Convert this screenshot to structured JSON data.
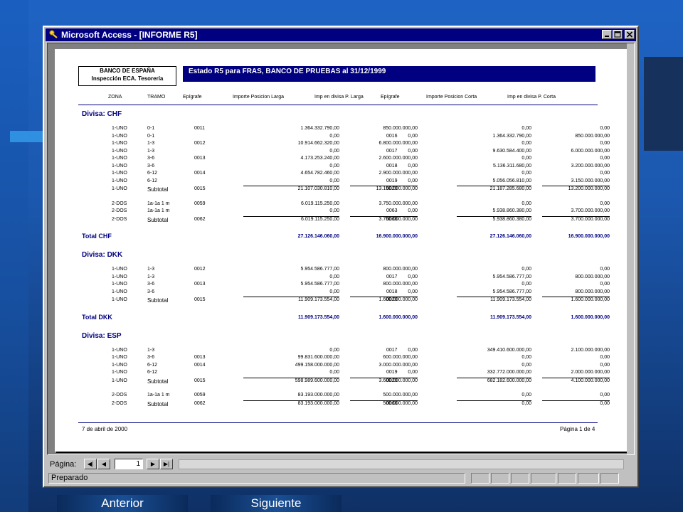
{
  "window": {
    "title": "Microsoft Access - [INFORME R5]",
    "icon": "key-icon"
  },
  "report": {
    "bank_line1": "BANCO DE ESPAÑA",
    "bank_line2": "Inspección ECA. Tesorería",
    "title": "Estado R5 para FRAS, BANCO DE PRUEBAS al 31/12/1999",
    "columns": [
      "ZONA",
      "TRAMO",
      "Epígrafe",
      "Importe Posicion Larga",
      "Imp en divisa P. Larga",
      "Epígrafe",
      "Importe Posicion Corta",
      "Imp en divisa P. Corta"
    ],
    "sections": [
      {
        "title": "Divisa: CHF",
        "total_label": "Total CHF",
        "totals": [
          "27.126.146.060,00",
          "16.900.000.000,00",
          "27.126.146.060,00",
          "16.900.000.000,00"
        ],
        "groups": [
          {
            "rows": [
              [
                "1-UNO",
                "0-1",
                "0011",
                "1.364.332.790,00",
                "850.000.000,00",
                "",
                "0,00",
                "0,00"
              ],
              [
                "1-UNO",
                "0-1",
                "",
                "0,00",
                "0,00",
                "0016",
                "1.364.332.790,00",
                "850.000.000,00"
              ],
              [
                "1-UNO",
                "1-3",
                "0012",
                "10.914.662.320,00",
                "6.800.000.000,00",
                "",
                "0,00",
                "0,00"
              ],
              [
                "1-UNO",
                "1-3",
                "",
                "0,00",
                "0,00",
                "0017",
                "9.630.584.400,00",
                "6.000.000.000,00"
              ],
              [
                "1-UNO",
                "3-6",
                "0013",
                "4.173.253.240,00",
                "2.600.000.000,00",
                "",
                "0,00",
                "0,00"
              ],
              [
                "1-UNO",
                "3-6",
                "",
                "0,00",
                "0,00",
                "0018",
                "5.136.311.680,00",
                "3.200.000.000,00"
              ],
              [
                "1-UNO",
                "6-12",
                "0014",
                "4.654.782.460,00",
                "2.900.000.000,00",
                "",
                "0,00",
                "0,00"
              ],
              [
                "1-UNO",
                "6-12",
                "",
                "0,00",
                "0,00",
                "0019",
                "5.056.056.810,00",
                "3.150.000.000,00"
              ]
            ],
            "subtotal": [
              "1-UNO",
              "Subtotal",
              "0015",
              "21.107.030.810,00",
              "13.150.000.000,00",
              "0020",
              "21.187.285.680,00",
              "13.200.000.000,00"
            ]
          },
          {
            "rows": [
              [
                "2-DOS",
                "1a-1a 1 m",
                "0059",
                "6.019.115.250,00",
                "3.750.000.000,00",
                "",
                "0,00",
                "0,00"
              ],
              [
                "2-DOS",
                "1a-1a 1 m",
                "",
                "0,00",
                "0,00",
                "0063",
                "5.938.860.380,00",
                "3.700.000.000,00"
              ]
            ],
            "subtotal": [
              "2-DOS",
              "Subtotal",
              "0062",
              "6.019.115.250,00",
              "3.750.000.000,00",
              "0066",
              "5.938.860.380,00",
              "3.700.000.000,00"
            ]
          }
        ]
      },
      {
        "title": "Divisa: DKK",
        "total_label": "Total DKK",
        "totals": [
          "11.909.173.554,00",
          "1.600.000.000,00",
          "11.909.173.554,00",
          "1.600.000.000,00"
        ],
        "groups": [
          {
            "rows": [
              [
                "1-UNO",
                "1-3",
                "0012",
                "5.954.586.777,00",
                "800.000.000,00",
                "",
                "0,00",
                "0,00"
              ],
              [
                "1-UNO",
                "1-3",
                "",
                "0,00",
                "0,00",
                "0017",
                "5.954.586.777,00",
                "800.000.000,00"
              ],
              [
                "1-UNO",
                "3-6",
                "0013",
                "5.954.586.777,00",
                "800.000.000,00",
                "",
                "0,00",
                "0,00"
              ],
              [
                "1-UNO",
                "3-6",
                "",
                "0,00",
                "0,00",
                "0018",
                "5.954.586.777,00",
                "800.000.000,00"
              ]
            ],
            "subtotal": [
              "1-UNO",
              "Subtotal",
              "0015",
              "11.909.173.554,00",
              "1.600.000.000,00",
              "0020",
              "11.909.173.554,00",
              "1.600.000.000,00"
            ]
          }
        ]
      },
      {
        "title": "Divisa: ESP",
        "groups": [
          {
            "rows": [
              [
                "1-UNO",
                "1-3",
                "",
                "0,00",
                "0,00",
                "0017",
                "349.410.600.000,00",
                "2.100.000.000,00"
              ],
              [
                "1-UNO",
                "3-6",
                "0013",
                "99.831.600.000,00",
                "600.000.000,00",
                "",
                "0,00",
                "0,00"
              ],
              [
                "1-UNO",
                "6-12",
                "0014",
                "499.158.000.000,00",
                "3.000.000.000,00",
                "",
                "0,00",
                "0,00"
              ],
              [
                "1-UNO",
                "6-12",
                "",
                "0,00",
                "0,00",
                "0019",
                "332.772.000.000,00",
                "2.000.000.000,00"
              ]
            ],
            "subtotal": [
              "1-UNO",
              "Subtotal",
              "0015",
              "598.989.600.000,00",
              "3.600.000.000,00",
              "0020",
              "682.182.600.000,00",
              "4.100.000.000,00"
            ]
          },
          {
            "rows": [
              [
                "2-DOS",
                "1a-1a 1 m",
                "0059",
                "83.193.000.000,00",
                "500.000.000,00",
                "",
                "0,00",
                "0,00"
              ]
            ],
            "subtotal": [
              "2-DOS",
              "Subtotal",
              "0062",
              "83.193.000.000,00",
              "500.000.000,00",
              "0066",
              "0,00",
              "0,00"
            ]
          }
        ]
      }
    ],
    "footer_date": "7 de abril de 2000",
    "footer_page": "Página 1 de 4"
  },
  "navigation": {
    "label": "Página:",
    "current_page": "1"
  },
  "status": {
    "text": "Preparado"
  },
  "slide_nav": {
    "prev": "Anterior",
    "next": "Siguiente"
  }
}
